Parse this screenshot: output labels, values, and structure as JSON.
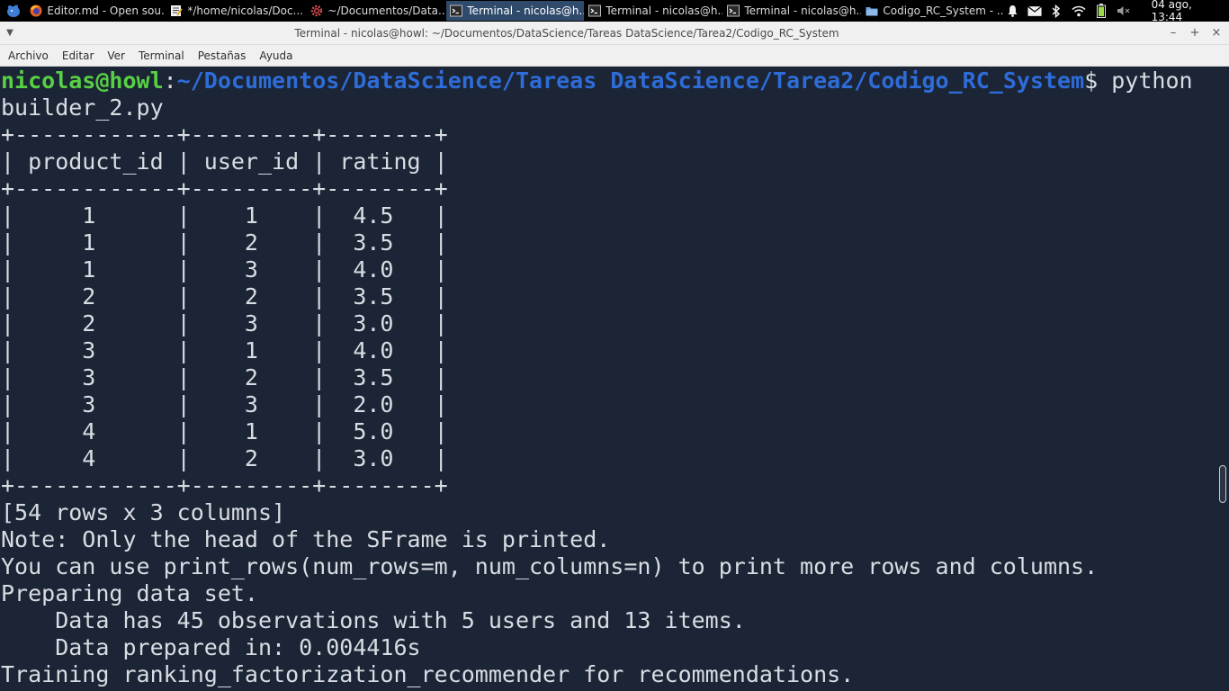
{
  "taskbar": {
    "start_icon": "xfce-mouse-icon",
    "tasks": [
      {
        "label": "Editor.md - Open sou...",
        "icon": "firefox-icon",
        "active": false
      },
      {
        "label": "*/home/nicolas/Doc...",
        "icon": "text-editor-icon",
        "active": false
      },
      {
        "label": "~/Documentos/Data...",
        "icon": "gear-icon",
        "active": false
      },
      {
        "label": "Terminal - nicolas@h...",
        "icon": "terminal-icon",
        "active": true
      },
      {
        "label": "Terminal - nicolas@h...",
        "icon": "terminal-icon",
        "active": false
      },
      {
        "label": "Terminal - nicolas@h...",
        "icon": "terminal-icon",
        "active": false
      },
      {
        "label": "Codigo_RC_System - ...",
        "icon": "folder-icon",
        "active": false
      }
    ],
    "tray": {
      "icons": [
        "bell-icon",
        "mail-icon",
        "bluetooth-icon",
        "wifi-icon",
        "battery-icon",
        "volume-muted-icon"
      ],
      "clock": "04 ago, 13:44"
    }
  },
  "window": {
    "title": "Terminal - nicolas@howl: ~/Documentos/DataScience/Tareas DataScience/Tarea2/Codigo_RC_System"
  },
  "menubar": {
    "items": [
      "Archivo",
      "Editar",
      "Ver",
      "Terminal",
      "Pestañas",
      "Ayuda"
    ]
  },
  "terminal": {
    "prompt": {
      "user_host": "nicolas@howl",
      "colon": ":",
      "path": "~/Documentos/DataScience/Tareas DataScience/Tarea2/Codigo_RC_System",
      "dollar": "$",
      "command": " python"
    },
    "lines": [
      "builder_2.py",
      "+------------+---------+--------+",
      "| product_id | user_id | rating |",
      "+------------+---------+--------+",
      "|     1      |    1    |  4.5   |",
      "|     1      |    2    |  3.5   |",
      "|     1      |    3    |  4.0   |",
      "|     2      |    2    |  3.5   |",
      "|     2      |    3    |  3.0   |",
      "|     3      |    1    |  4.0   |",
      "|     3      |    2    |  3.5   |",
      "|     3      |    3    |  2.0   |",
      "|     4      |    1    |  5.0   |",
      "|     4      |    2    |  3.0   |",
      "+------------+---------+--------+",
      "[54 rows x 3 columns]",
      "Note: Only the head of the SFrame is printed.",
      "You can use print_rows(num_rows=m, num_columns=n) to print more rows and columns.",
      "Preparing data set.",
      "    Data has 45 observations with 5 users and 13 items.",
      "    Data prepared in: 0.004416s",
      "Training ranking_factorization_recommender for recommendations."
    ]
  },
  "colors": {
    "terminal_bg": "#1b2536",
    "terminal_fg": "#d9dde3",
    "prompt_user": "#57d143",
    "prompt_path": "#2e6cd8",
    "taskbar_bg": "#000000",
    "active_task_bg": "#2f4a6b"
  }
}
